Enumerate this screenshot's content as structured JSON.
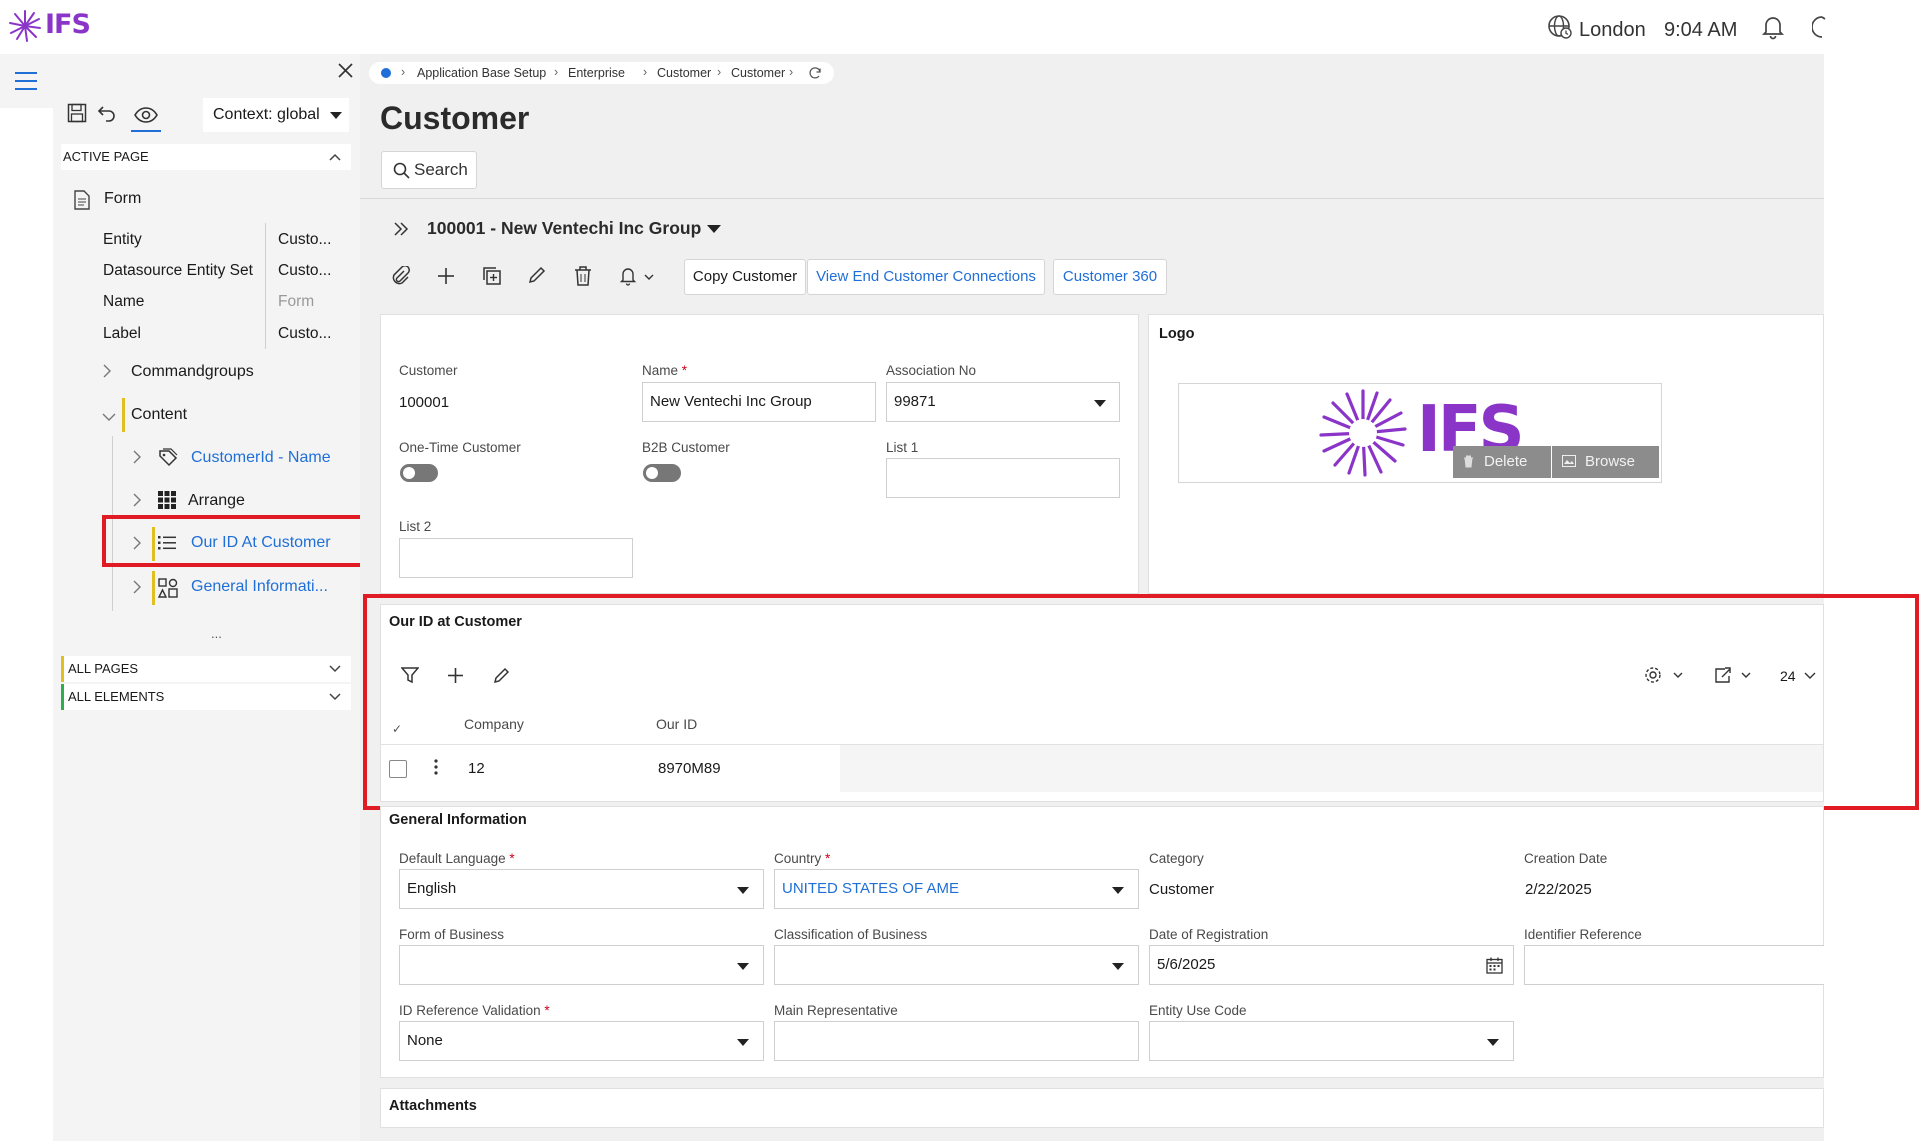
{
  "brand": {
    "logo_text": "IFS"
  },
  "header": {
    "location": "London",
    "time": "9:04 AM"
  },
  "designer": {
    "context_label": "Context: global",
    "active_page_label": "ACTIVE PAGE",
    "form_label": "Form",
    "properties": [
      {
        "label": "Entity",
        "value": "Custo..."
      },
      {
        "label": "Datasource Entity Set",
        "value": "Custo..."
      },
      {
        "label": "Name",
        "value": "Form"
      },
      {
        "label": "Label",
        "value": "Custo..."
      }
    ],
    "commandgroups_label": "Commandgroups",
    "content_label": "Content",
    "content_items": [
      {
        "label": "CustomerId - Name"
      },
      {
        "label": "Arrange"
      },
      {
        "label": "Our ID At Customer"
      },
      {
        "label": "General Informati..."
      }
    ],
    "more_label": "...",
    "all_pages_label": "ALL PAGES",
    "all_elements_label": "ALL ELEMENTS"
  },
  "breadcrumb": [
    "Application Base Setup",
    "Enterprise",
    "Customer",
    "Customer"
  ],
  "page": {
    "title": "Customer",
    "search_label": "Search",
    "record_title": "100001 - New Ventechi Inc Group"
  },
  "commands": {
    "copy_customer": "Copy Customer",
    "view_end_customer": "View End Customer Connections",
    "customer_360": "Customer 360"
  },
  "customer_card": {
    "customer_label": "Customer",
    "customer_value": "100001",
    "name_label": "Name",
    "name_value": "New Ventechi Inc Group",
    "assoc_label": "Association No",
    "assoc_value": "99871",
    "one_time_label": "One-Time Customer",
    "b2b_label": "B2B Customer",
    "list1_label": "List 1",
    "list2_label": "List 2"
  },
  "logo_card": {
    "title": "Logo",
    "logo_text": "IFS",
    "delete_label": "Delete",
    "browse_label": "Browse"
  },
  "our_id": {
    "title": "Our ID at Customer",
    "page_size": "24",
    "columns": [
      "Company",
      "Our ID"
    ],
    "rows": [
      {
        "company": "12",
        "our_id": "8970M89"
      }
    ]
  },
  "general": {
    "title": "General Information",
    "default_language_label": "Default Language",
    "default_language_value": "English",
    "country_label": "Country",
    "country_value": "UNITED STATES OF AME",
    "category_label": "Category",
    "category_value": "Customer",
    "creation_date_label": "Creation Date",
    "creation_date_value": "2/22/2025",
    "form_of_business_label": "Form of Business",
    "classification_label": "Classification of Business",
    "date_registration_label": "Date of Registration",
    "date_registration_value": "5/6/2025",
    "identifier_label": "Identifier Reference",
    "id_ref_validation_label": "ID Reference Validation",
    "id_ref_validation_value": "None",
    "main_rep_label": "Main Representative",
    "entity_use_label": "Entity Use Code"
  },
  "attachments": {
    "title": "Attachments"
  },
  "colors": {
    "accent": "#1f6fd6",
    "brand": "#8a35c8",
    "highlight": "#e01b24"
  }
}
